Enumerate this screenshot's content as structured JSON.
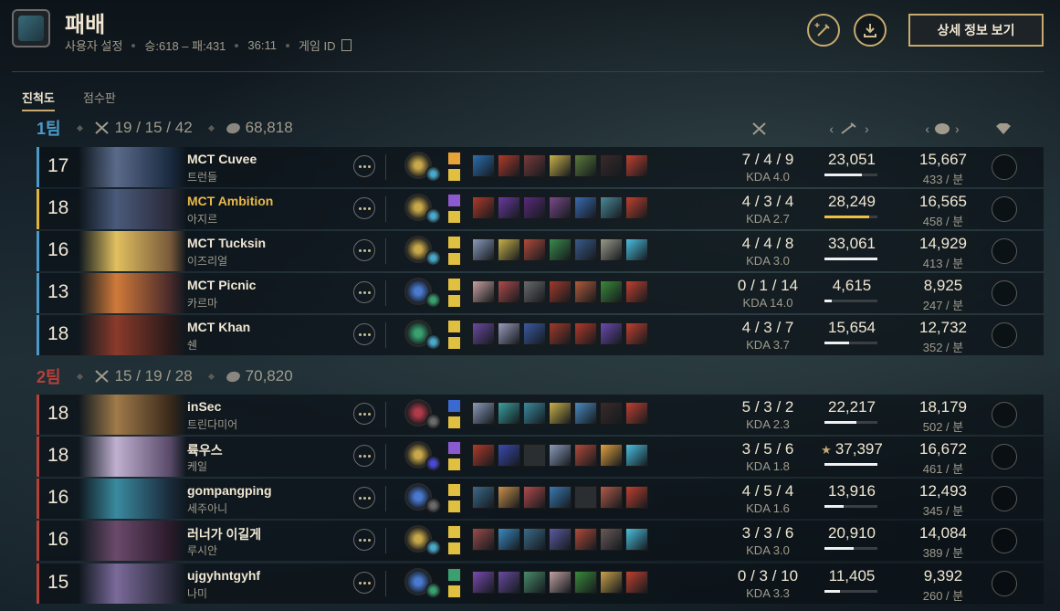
{
  "header": {
    "title": "패배",
    "user_settings": "사용자 설정",
    "record": "승:618 – 패:431",
    "duration": "36:11",
    "game_id_label": "게임 ID",
    "detail_button": "상세 정보 보기"
  },
  "tabs": [
    {
      "label": "진척도",
      "active": true
    },
    {
      "label": "점수판",
      "active": false
    }
  ],
  "colors": {
    "team1": "#4d9ac7",
    "team2": "#b5403a",
    "accent": "#c8aa6e",
    "me": "#e8b84a"
  },
  "teams": [
    {
      "name": "1팀",
      "kda": "19 / 15 / 42",
      "gold": "68,818",
      "players": [
        {
          "level": "17",
          "name": "MCT Cuvee",
          "champion": "트런들",
          "kda": "7 / 4 / 9",
          "ratio": "KDA 4.0",
          "damage": "23,051",
          "damage_pct": 70,
          "gold": "15,667",
          "gpm": "433 / 분",
          "me": false,
          "star": false,
          "rune": "#c8a84a",
          "runeSec": "#4aa8c8",
          "spells": [
            "#e8a23a",
            "#e0c040"
          ],
          "items": [
            "#2a6fb0",
            "#b03a2a",
            "#7a3a3a",
            "#c8b04a",
            "#5a7a3a",
            "#3a2a2a",
            "#c04030"
          ],
          "portrait": [
            "#5a6a8a",
            "#1a2a40"
          ]
        },
        {
          "level": "18",
          "name": "MCT Ambition",
          "champion": "아지르",
          "kda": "4 / 3 / 4",
          "ratio": "KDA 2.7",
          "damage": "28,249",
          "damage_pct": 85,
          "gold": "16,565",
          "gpm": "458 / 분",
          "me": true,
          "star": false,
          "rune": "#c8a84a",
          "runeSec": "#4aa8c8",
          "spells": [
            "#8a5ad0",
            "#e0c040"
          ],
          "items": [
            "#b03a2a",
            "#6a3aa0",
            "#5a2a7a",
            "#7a4a8a",
            "#3a6ab0",
            "#4a8a9a",
            "#c04030"
          ],
          "portrait": [
            "#4a5a7a",
            "#2a2a3a"
          ]
        },
        {
          "level": "16",
          "name": "MCT Tucksin",
          "champion": "이즈리얼",
          "kda": "4 / 4 / 8",
          "ratio": "KDA 3.0",
          "damage": "33,061",
          "damage_pct": 100,
          "gold": "14,929",
          "gpm": "413 / 분",
          "me": false,
          "star": false,
          "rune": "#c8a84a",
          "runeSec": "#4aa8c8",
          "spells": [
            "#e0c040",
            "#e0c040"
          ],
          "items": [
            "#8a9aba",
            "#c8b04a",
            "#b04a3a",
            "#3a8a4a",
            "#3a5a8a",
            "#9a9a8a",
            "#4ac0e0"
          ],
          "portrait": [
            "#e0c060",
            "#7a5a3a"
          ]
        },
        {
          "level": "13",
          "name": "MCT Picnic",
          "champion": "카르마",
          "kda": "0 / 1 / 14",
          "ratio": "KDA 14.0",
          "damage": "4,615",
          "damage_pct": 14,
          "gold": "8,925",
          "gpm": "247 / 분",
          "me": false,
          "star": false,
          "rune": "#4a7ad0",
          "runeSec": "#3aa070",
          "spells": [
            "#e0c040",
            "#e0c040"
          ],
          "items": [
            "#c8a0a0",
            "#b04a4a",
            "#6a6a6a",
            "#a03a2a",
            "#b05a3a",
            "#3a8a3a",
            "#c04030"
          ],
          "portrait": [
            "#d07a3a",
            "#4a2a2a"
          ]
        },
        {
          "level": "18",
          "name": "MCT Khan",
          "champion": "쉔",
          "kda": "4 / 3 / 7",
          "ratio": "KDA 3.7",
          "damage": "15,654",
          "damage_pct": 47,
          "gold": "12,732",
          "gpm": "352 / 분",
          "me": false,
          "star": false,
          "rune": "#3aa070",
          "runeSec": "#4aa8c8",
          "spells": [
            "#e0c040",
            "#e0c040"
          ],
          "items": [
            "#6a4aa0",
            "#9a9aba",
            "#3a5aa0",
            "#a03a2a",
            "#b03a2a",
            "#6a4ab0",
            "#c04030"
          ],
          "portrait": [
            "#8a3a2a",
            "#2a1a1a"
          ]
        }
      ]
    },
    {
      "name": "2팀",
      "kda": "15 / 19 / 28",
      "gold": "70,820",
      "players": [
        {
          "level": "18",
          "name": "inSec",
          "champion": "트린다미어",
          "kda": "5 / 3 / 2",
          "ratio": "KDA 2.3",
          "damage": "22,217",
          "damage_pct": 60,
          "gold": "18,179",
          "gpm": "502 / 분",
          "me": false,
          "star": false,
          "rune": "#b03a4a",
          "runeSec": "#6a6a6a",
          "spells": [
            "#3a6ad0",
            "#e0c040"
          ],
          "items": [
            "#8a9aba",
            "#3aa0a0",
            "#3a8aa0",
            "#c8b04a",
            "#4a8ac0",
            "#3a2a2a",
            "#c04030"
          ],
          "portrait": [
            "#a07a4a",
            "#3a2a1a"
          ]
        },
        {
          "level": "18",
          "name": "륙우스",
          "champion": "케일",
          "kda": "3 / 5 / 6",
          "ratio": "KDA 1.8",
          "damage": "37,397",
          "damage_pct": 100,
          "gold": "16,672",
          "gpm": "461 / 분",
          "me": false,
          "star": true,
          "rune": "#c8a84a",
          "runeSec": "#4a4ad0",
          "spells": [
            "#8a5ad0",
            "#e0c040"
          ],
          "items": [
            "#b03a2a",
            "#3a4ab0",
            "#2b2e31",
            "#8a9aba",
            "#b04a3a",
            "#e0a040",
            "#4ac0e0"
          ],
          "portrait": [
            "#c0b0d0",
            "#5a4a6a"
          ]
        },
        {
          "level": "16",
          "name": "gompangping",
          "champion": "세주아니",
          "kda": "4 / 5 / 4",
          "ratio": "KDA 1.6",
          "damage": "13,916",
          "damage_pct": 37,
          "gold": "12,493",
          "gpm": "345 / 분",
          "me": false,
          "star": false,
          "rune": "#4a7ad0",
          "runeSec": "#6a6a6a",
          "spells": [
            "#e0c040",
            "#e0c040"
          ],
          "items": [
            "#3a6a8a",
            "#c8904a",
            "#b04a4a",
            "#3a7ab0",
            "#2b2e31",
            "#b05a4a",
            "#c04030"
          ],
          "portrait": [
            "#3a8aa0",
            "#1a2a3a"
          ]
        },
        {
          "level": "16",
          "name": "러너가 이길게",
          "champion": "루시안",
          "kda": "3 / 3 / 6",
          "ratio": "KDA 3.0",
          "damage": "20,910",
          "damage_pct": 56,
          "gold": "14,084",
          "gpm": "389 / 분",
          "me": false,
          "star": false,
          "rune": "#c8a84a",
          "runeSec": "#4aa8c8",
          "spells": [
            "#e0c040",
            "#e0c040"
          ],
          "items": [
            "#9a4a4a",
            "#3a8ac0",
            "#3a6a8a",
            "#5a5aa0",
            "#b04a3a",
            "#6a5a5a",
            "#4ac0e0"
          ],
          "portrait": [
            "#6a4a6a",
            "#2a1a2a"
          ]
        },
        {
          "level": "15",
          "name": "ujgyhntgyhf",
          "champion": "나미",
          "kda": "0 / 3 / 10",
          "ratio": "KDA 3.3",
          "damage": "11,405",
          "damage_pct": 30,
          "gold": "9,392",
          "gpm": "260 / 분",
          "me": false,
          "star": false,
          "rune": "#4a7ad0",
          "runeSec": "#3aa070",
          "spells": [
            "#3aa070",
            "#e0c040"
          ],
          "items": [
            "#7a4ab0",
            "#6a4aa0",
            "#4a8a6a",
            "#c0a0a0",
            "#3a8a3a",
            "#c8a04a",
            "#c04030"
          ],
          "portrait": [
            "#7a6a9a",
            "#2a2a3a"
          ]
        }
      ]
    }
  ]
}
